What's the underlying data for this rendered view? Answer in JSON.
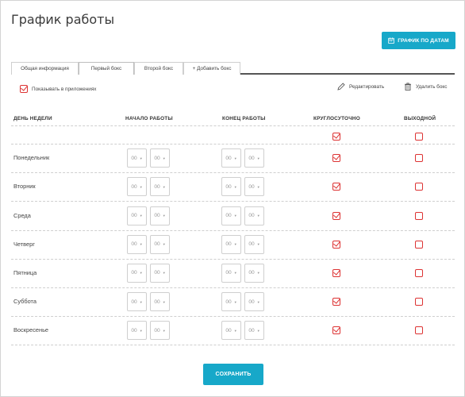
{
  "page": {
    "title": "График работы"
  },
  "toolbar": {
    "dates_button": "ГРАФИК ПО ДАТАМ",
    "dates_icon": "calendar-icon"
  },
  "tabs": [
    {
      "label": "Общая информация",
      "active": false
    },
    {
      "label": "Первый бокс",
      "active": true
    },
    {
      "label": "Второй бокс",
      "active": false
    },
    {
      "label": "+ Добавить бокс",
      "active": false
    }
  ],
  "box": {
    "show_in_app_label": "Показывать в приложениях",
    "show_in_app_checked": true,
    "edit_label": "Редактировать",
    "delete_label": "Удалить бокс"
  },
  "table": {
    "headers": {
      "day": "ДЕНЬ НЕДЕЛИ",
      "start": "НАЧАЛО РАБОТЫ",
      "end": "КОНЕЦ РАБОТЫ",
      "allday": "КРУГЛОСУТОЧНО",
      "dayoff": "ВЫХОДНОЙ"
    },
    "all_row": {
      "allday": true,
      "dayoff": false
    },
    "rows": [
      {
        "day": "Понедельник",
        "start_h": "00",
        "start_m": "00",
        "end_h": "00",
        "end_m": "00",
        "allday": true,
        "dayoff": false
      },
      {
        "day": "Вторник",
        "start_h": "00",
        "start_m": "00",
        "end_h": "00",
        "end_m": "00",
        "allday": true,
        "dayoff": false
      },
      {
        "day": "Среда",
        "start_h": "00",
        "start_m": "00",
        "end_h": "00",
        "end_m": "00",
        "allday": true,
        "dayoff": false
      },
      {
        "day": "Четверг",
        "start_h": "00",
        "start_m": "00",
        "end_h": "00",
        "end_m": "00",
        "allday": true,
        "dayoff": false
      },
      {
        "day": "Пятница",
        "start_h": "00",
        "start_m": "00",
        "end_h": "00",
        "end_m": "00",
        "allday": true,
        "dayoff": false
      },
      {
        "day": "Суббота",
        "start_h": "00",
        "start_m": "00",
        "end_h": "00",
        "end_m": "00",
        "allday": true,
        "dayoff": false
      },
      {
        "day": "Воскресенье",
        "start_h": "00",
        "start_m": "00",
        "end_h": "00",
        "end_m": "00",
        "allday": true,
        "dayoff": false
      }
    ]
  },
  "footer": {
    "save_label": "СОХРАНИТЬ"
  },
  "colors": {
    "accent": "#17a8c9",
    "checkbox": "#dd3333"
  }
}
